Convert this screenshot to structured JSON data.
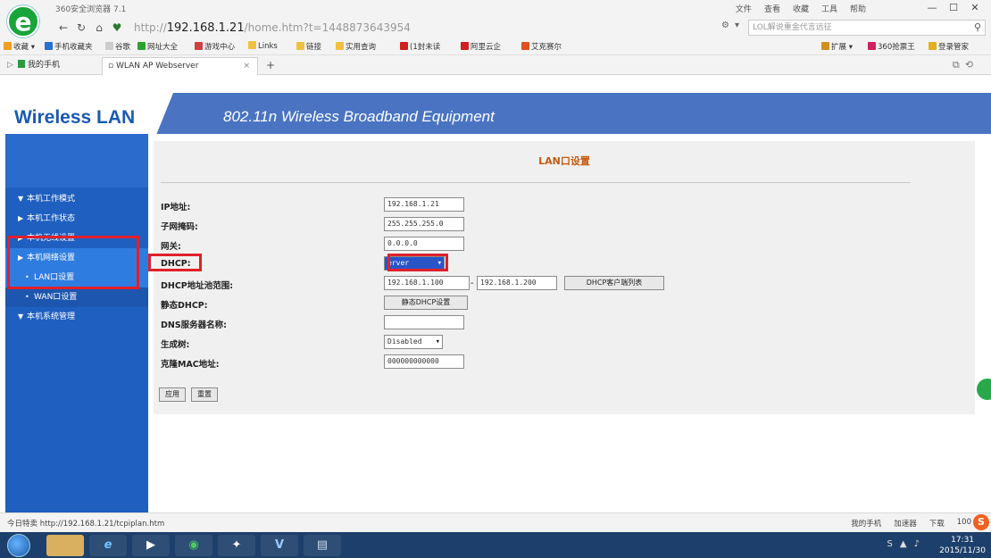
{
  "browser": {
    "app_title": "360安全浏览器 7.1",
    "logo_glyph": "e",
    "title_menu": [
      "文件",
      "查看",
      "收藏",
      "工具",
      "帮助"
    ],
    "address": {
      "scheme": "http://",
      "host": "192.168.1.21",
      "path": "/home.htm?t=1448873643954"
    },
    "search_placeholder": "LOL解说重金代言远征",
    "bookmarks": [
      {
        "label": "收藏",
        "color": "#f0a020"
      },
      {
        "label": "手机收藏夹",
        "color": "#2a70d0"
      },
      {
        "label": "谷歌",
        "color": "#888888"
      },
      {
        "label": "网址大全",
        "color": "#30a030"
      },
      {
        "label": "游戏中心",
        "color": "#d04040"
      },
      {
        "label": "Links",
        "color": "#f0c040"
      },
      {
        "label": "链接",
        "color": "#f0c040"
      },
      {
        "label": "实用查询",
        "color": "#f0c040"
      },
      {
        "label": "(1封未读",
        "color": "#d02020"
      },
      {
        "label": "阿里云企",
        "color": "#d02020"
      },
      {
        "label": "艾克赛尔",
        "color": "#e05020"
      }
    ],
    "bookmarks_right": [
      "扩展",
      "360抢票王",
      "登录管家"
    ],
    "tabs": {
      "side_label": "我的手机",
      "active_label": "WLAN AP Webserver"
    }
  },
  "page": {
    "brand": "Wireless LAN",
    "header_title": "802.11n Wireless Broadband Equipment",
    "sidebar": [
      {
        "label": "本机工作模式",
        "arrow": "▼",
        "type": "group"
      },
      {
        "label": "本机工作状态",
        "arrow": "▶",
        "type": "group"
      },
      {
        "label": "本机无线设置",
        "arrow": "▶",
        "type": "group"
      },
      {
        "label": "本机网络设置",
        "arrow": "▶",
        "type": "group"
      },
      {
        "label": "LAN口设置",
        "arrow": "•",
        "type": "sub"
      },
      {
        "label": "WAN口设置",
        "arrow": "•",
        "type": "sub"
      },
      {
        "label": "本机系统管理",
        "arrow": "▼",
        "type": "group"
      }
    ],
    "form": {
      "title": "LAN口设置",
      "ip_label": "IP地址:",
      "ip_value": "192.168.1.21",
      "mask_label": "子网掩码:",
      "mask_value": "255.255.255.0",
      "gateway_label": "网关:",
      "gateway_value": "0.0.0.0",
      "dhcp_label": "DHCP:",
      "dhcp_value": "erver",
      "range_label": "DHCP地址池范围:",
      "range_start": "192.168.1.100",
      "range_sep": "-",
      "range_end": "192.168.1.200",
      "client_list_button": "DHCP客户端列表",
      "static_label": "静态DHCP:",
      "static_button": "静态DHCP设置",
      "dns_label": "DNS服务器名称:",
      "dns_value": "",
      "stp_label": "生成树:",
      "stp_value": "Disabled",
      "mac_label": "克隆MAC地址:",
      "mac_value": "000000000000",
      "apply_button": "应用",
      "reset_button": "重置"
    }
  },
  "statusbar": {
    "left": "今日特卖",
    "url": "http://192.168.1.21/tcpiplan.htm",
    "right": [
      "我的手机",
      "加速器",
      "下载"
    ],
    "zoom": "100"
  },
  "taskbar": {
    "time": "17:31",
    "date": "2015/11/30"
  }
}
